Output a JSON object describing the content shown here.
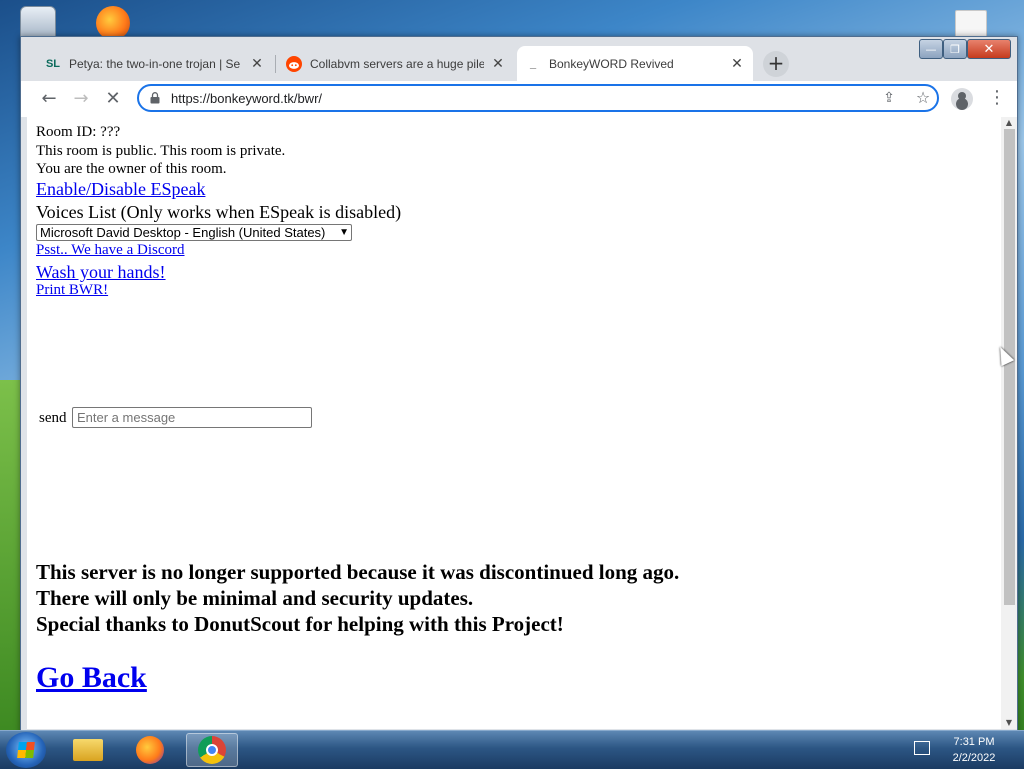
{
  "browser": {
    "tabs": [
      {
        "favicon": "SL",
        "title": "Petya: the two-in-one trojan | Se",
        "active": false
      },
      {
        "favicon": "reddit-icon",
        "title": "Collabvm servers are a huge pile",
        "active": false
      },
      {
        "favicon": "loading-icon",
        "title": "BonkeyWORD Revived",
        "active": true
      }
    ],
    "url": "https://bonkeyword.tk/bwr/"
  },
  "page": {
    "room_id": "Room ID: ???",
    "privacy": "This room is public. This room is private.",
    "owner": "You are the owner of this room.",
    "espeak_link": "Enable/Disable ESpeak",
    "voices_label": "Voices List (Only works when ESpeak is disabled)",
    "voice_selected": "Microsoft David Desktop - English (United States)",
    "discord_link": "Psst.. We have a Discord",
    "wash_link": "Wash your hands!",
    "print_link": "Print BWR!",
    "send_label": "send",
    "message_placeholder": "Enter a message",
    "notice": [
      "This server is no longer supported because it was discontinued long ago.",
      "There will only be minimal and security updates.",
      "Special thanks to DonutScout for helping with this Project!"
    ],
    "go_back": "Go Back"
  },
  "taskbar": {
    "time": "7:31 PM",
    "date": "2/2/2022"
  }
}
